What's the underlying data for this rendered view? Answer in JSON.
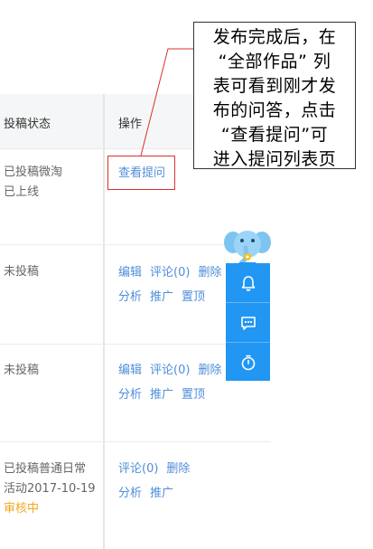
{
  "table": {
    "headers": {
      "status": "投稿状态",
      "actions": "操作"
    },
    "rows": [
      {
        "status_line1": "已投稿微淘",
        "status_line2": "已上线",
        "status_line3": "",
        "ops_line1": [
          "查看提问"
        ],
        "ops_line2": []
      },
      {
        "status_line1": "未投稿",
        "status_line2": "",
        "status_line3": "",
        "ops_line1": [
          "编辑",
          "评论(0)",
          "删除"
        ],
        "ops_line2": [
          "分析",
          "推广",
          "置顶"
        ]
      },
      {
        "status_line1": "未投稿",
        "status_line2": "",
        "status_line3": "",
        "ops_line1": [
          "编辑",
          "评论(0)",
          "删除"
        ],
        "ops_line2": [
          "分析",
          "推广",
          "置顶"
        ]
      },
      {
        "status_line1": "已投稿普通日常",
        "status_line2": "活动2017-10-19",
        "status_line3": "审核中",
        "ops_line1": [
          "评论(0)",
          "删除"
        ],
        "ops_line2": [
          "分析",
          "推广"
        ]
      }
    ]
  },
  "callout": {
    "lines": [
      "发布完成后，在",
      "“全部作品” 列",
      "表可看到刚才发",
      "布的问答，点击",
      "“查看提问”可",
      "进入提问列表页"
    ]
  },
  "float_bar": {
    "buttons": [
      {
        "icon": "bell-icon"
      },
      {
        "icon": "chat-icon"
      },
      {
        "icon": "timer-icon"
      }
    ],
    "color": "#2196f3"
  },
  "colors": {
    "link": "#4f8ed9",
    "highlight": "#d9312b",
    "pending": "#f5a623"
  }
}
